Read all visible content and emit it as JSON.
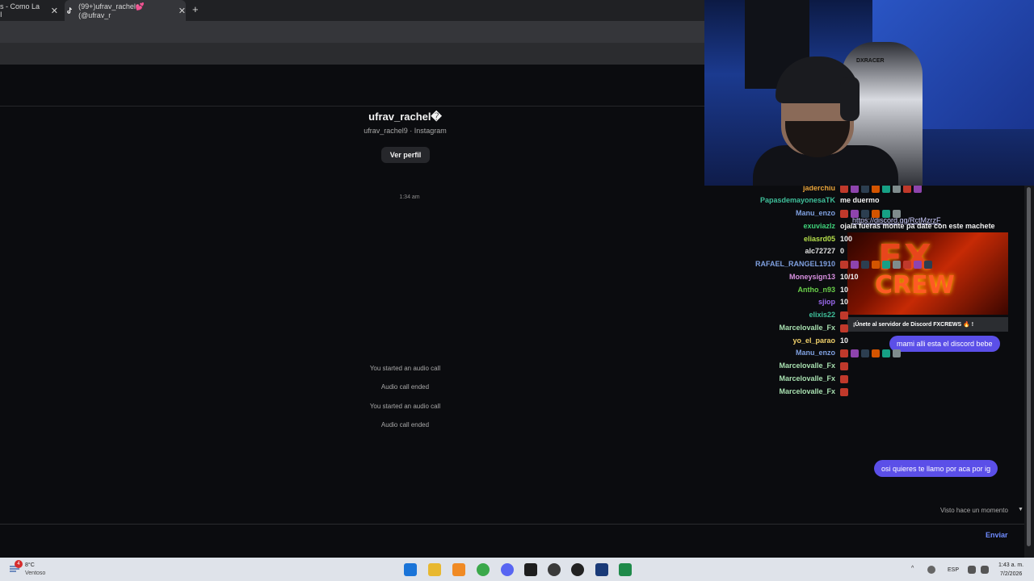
{
  "browser": {
    "tabs": [
      {
        "label": "s - Como La I"
      },
      {
        "label": "(99+)ufrav_rachel💕 (@ufrav_r"
      }
    ],
    "new_tab": "+"
  },
  "dm": {
    "profile_name": "ufrav_rachel�",
    "profile_sub": "ufrav_rachel9 · Instagram",
    "view_profile": "Ver perfil",
    "timestamp": "1:34 am",
    "call_events": [
      "You started an audio call",
      "Audio call ended",
      "You started an audio call",
      "Audio call ended"
    ],
    "bubbles": [
      {
        "text": "mami alli esta el discord bebe"
      },
      {
        "text": "osi quieres te llamo por aca por ig"
      }
    ],
    "discord_link": "https://discord.gg/RctMzrzF",
    "discord_caption": "¡Únete al servidor de Discord FXCREWS 🔥 !",
    "discord_logo_1": "FX",
    "discord_logo_2": "CREW",
    "seen": "Visto hace un momento",
    "send": "Enviar",
    "input_placeholder": ""
  },
  "chat": [
    {
      "user": "jaderchiu",
      "color": "#e8a33a",
      "msg": "",
      "emotes": 8
    },
    {
      "user": "PapasdemayonesaTK",
      "color": "#3fbf9a",
      "msg": "me duermo",
      "emotes": 0
    },
    {
      "user": "Manu_enzo",
      "color": "#7fa0e0",
      "msg": "",
      "emotes": 6
    },
    {
      "user": "exuviazlz",
      "color": "#3fd27a",
      "msg": "ojala fueras monte pa date con este machete",
      "emotes": 0
    },
    {
      "user": "eliasrd05",
      "color": "#b6e04a",
      "msg": "100",
      "emotes": 0
    },
    {
      "user": "alc72727",
      "color": "#e0e0e0",
      "msg": "0",
      "emotes": 0
    },
    {
      "user": "RAFAEL_RANGEL1910",
      "color": "#7fa0e0",
      "msg": "",
      "emotes": 9
    },
    {
      "user": "Moneysign13",
      "color": "#d890e0",
      "msg": "10/10",
      "emotes": 0
    },
    {
      "user": "Antho_n93",
      "color": "#6ad04a",
      "msg": "10",
      "emotes": 0
    },
    {
      "user": "sjiop",
      "color": "#9b6af0",
      "msg": "10",
      "emotes": 0
    },
    {
      "user": "elixis22",
      "color": "#3fbf9a",
      "msg": "",
      "emotes": 1
    },
    {
      "user": "Marcelovalle_Fx",
      "color": "#a8e0b0",
      "msg": "",
      "emotes": 1
    },
    {
      "user": "yo_el_parao",
      "color": "#f0d06a",
      "msg": "10",
      "emotes": 0
    },
    {
      "user": "Manu_enzo",
      "color": "#7fa0e0",
      "msg": "",
      "emotes": 6
    },
    {
      "user": "Marcelovalle_Fx",
      "color": "#a8e0b0",
      "msg": "",
      "emotes": 1
    },
    {
      "user": "Marcelovalle_Fx",
      "color": "#a8e0b0",
      "msg": "",
      "emotes": 1
    },
    {
      "user": "Marcelovalle_Fx",
      "color": "#a8e0b0",
      "msg": "",
      "emotes": 1
    }
  ],
  "webcam": {
    "chair_brand": "DXRACER"
  },
  "taskbar": {
    "weather_temp": "8°C",
    "weather_cond": "Ventoso",
    "weather_badge": "4",
    "lang": "ESP",
    "time": "1:43 a. m.",
    "date": "7/2/2026",
    "tray_up": "^"
  }
}
